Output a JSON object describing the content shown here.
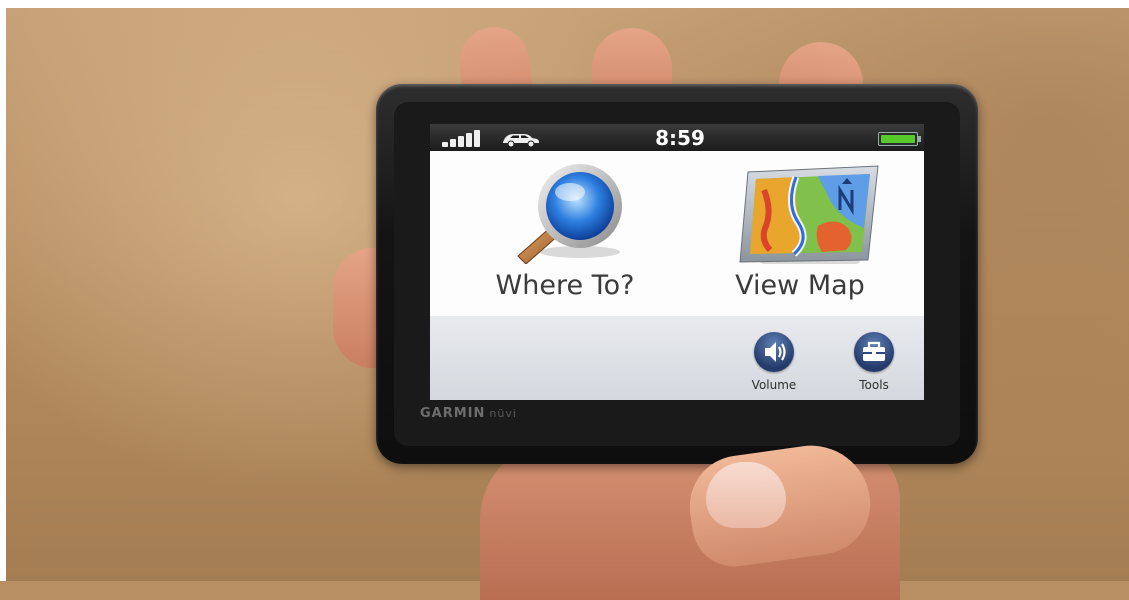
{
  "device": {
    "brand": "GARMIN",
    "model": "nüvi"
  },
  "status_bar": {
    "time": "8:59",
    "signal_icon": "signal-strength-icon",
    "vehicle_icon": "car-icon",
    "battery_icon": "battery-icon",
    "battery_level": 1.0
  },
  "main_menu": {
    "where_to": {
      "label": "Where To?",
      "icon": "magnifying-glass-icon"
    },
    "view_map": {
      "label": "View Map",
      "icon": "map-icon"
    }
  },
  "bottom_bar": {
    "volume": {
      "label": "Volume",
      "icon": "speaker-icon"
    },
    "tools": {
      "label": "Tools",
      "icon": "toolbox-icon"
    }
  },
  "colors": {
    "status_bar_bg": "#1b1b1b",
    "screen_bg": "#fdfdfd",
    "battery_green": "#58c92a",
    "button_blue": "#2c4a80"
  }
}
